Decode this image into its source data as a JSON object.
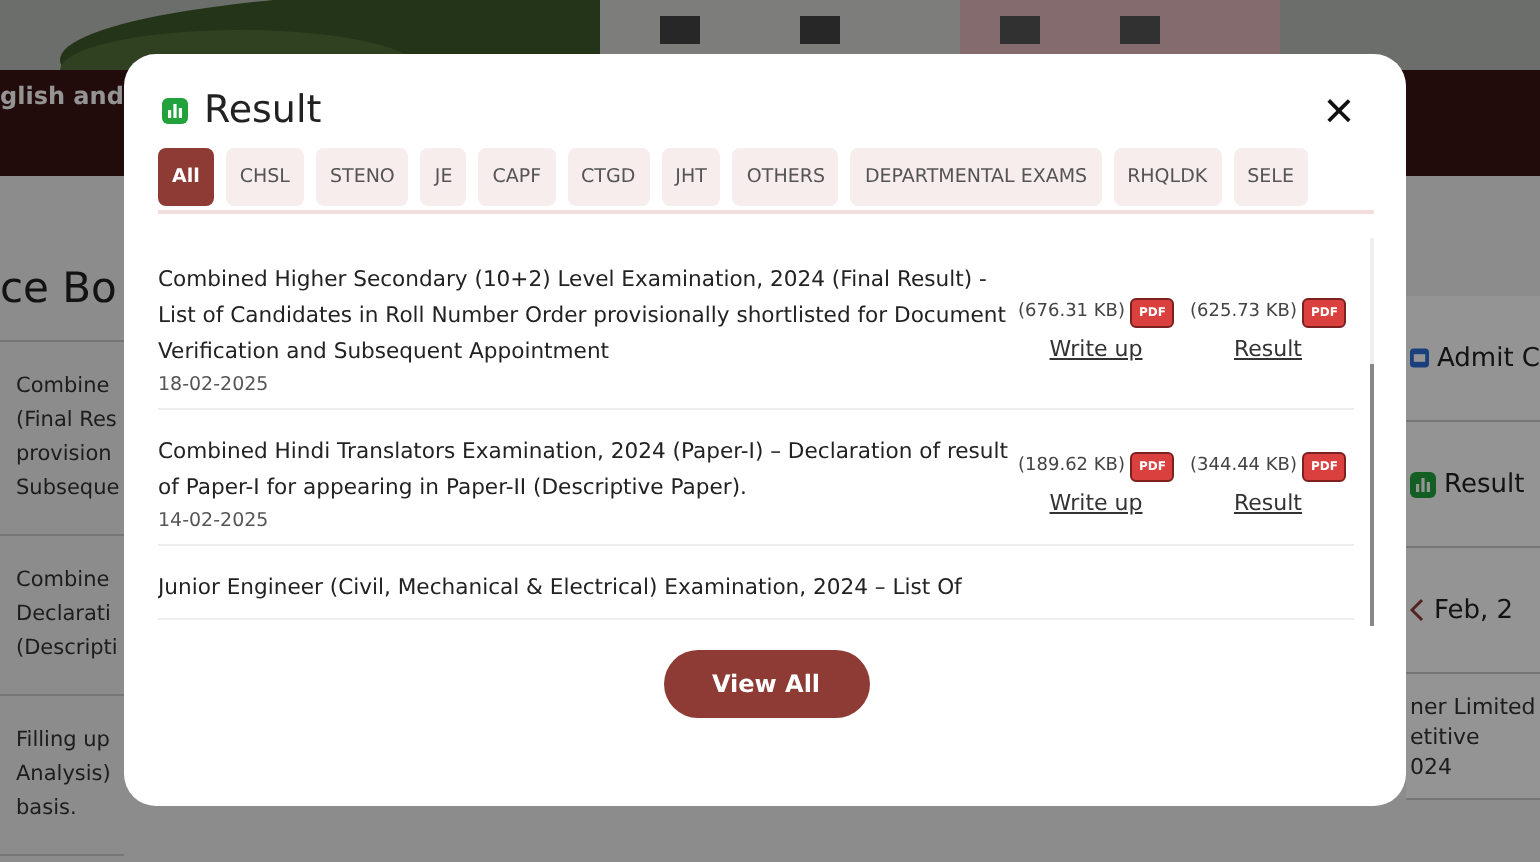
{
  "background": {
    "header_text": "glish and",
    "heading": "ce Bo",
    "left_items": [
      {
        "lines": [
          "Combine",
          "(Final Res",
          "provision",
          "Subseque"
        ]
      },
      {
        "lines": [
          "Combine",
          "Declarati",
          "(Descripti"
        ]
      },
      {
        "lines": [
          "Filling up",
          "Analysis)",
          "basis."
        ]
      }
    ],
    "right_items": [
      {
        "kind": "admit",
        "label": "Admit C"
      },
      {
        "kind": "result",
        "label": "Result"
      },
      {
        "kind": "month",
        "label": "Feb, 2"
      },
      {
        "kind": "notice",
        "label": "ner Limited\netitive\n024"
      }
    ]
  },
  "modal": {
    "title": "Result",
    "close": "×",
    "tabs": [
      {
        "label": "All",
        "selected": true
      },
      {
        "label": "CHSL",
        "selected": false
      },
      {
        "label": "STENO",
        "selected": false
      },
      {
        "label": "JE",
        "selected": false
      },
      {
        "label": "CAPF",
        "selected": false
      },
      {
        "label": "CTGD",
        "selected": false
      },
      {
        "label": "JHT",
        "selected": false
      },
      {
        "label": "OTHERS",
        "selected": false
      },
      {
        "label": "DEPARTMENTAL EXAMS",
        "selected": false
      },
      {
        "label": "RHQLDK",
        "selected": false
      },
      {
        "label": "SELE",
        "selected": false
      }
    ],
    "results": [
      {
        "title": "Combined Higher Secondary (10+2) Level Examination, 2024 (Final Result) - List of Candidates in Roll Number Order provisionally shortlisted for Document Verification and Subsequent Appointment",
        "date": "18-02-2025",
        "files": [
          {
            "size": "(676.31 KB)",
            "badge": "PDF",
            "link": "Write up"
          },
          {
            "size": "(625.73 KB)",
            "badge": "PDF",
            "link": "Result"
          }
        ]
      },
      {
        "title": "Combined Hindi Translators Examination, 2024 (Paper-I) – Declaration of result of Paper-I for appearing in Paper-II (Descriptive Paper).",
        "date": "14-02-2025",
        "files": [
          {
            "size": "(189.62 KB)",
            "badge": "PDF",
            "link": "Write up"
          },
          {
            "size": "(344.44 KB)",
            "badge": "PDF",
            "link": "Result"
          }
        ]
      },
      {
        "title": "Junior Engineer (Civil, Mechanical & Electrical) Examination, 2024 – List Of"
      }
    ],
    "button": "View All"
  }
}
